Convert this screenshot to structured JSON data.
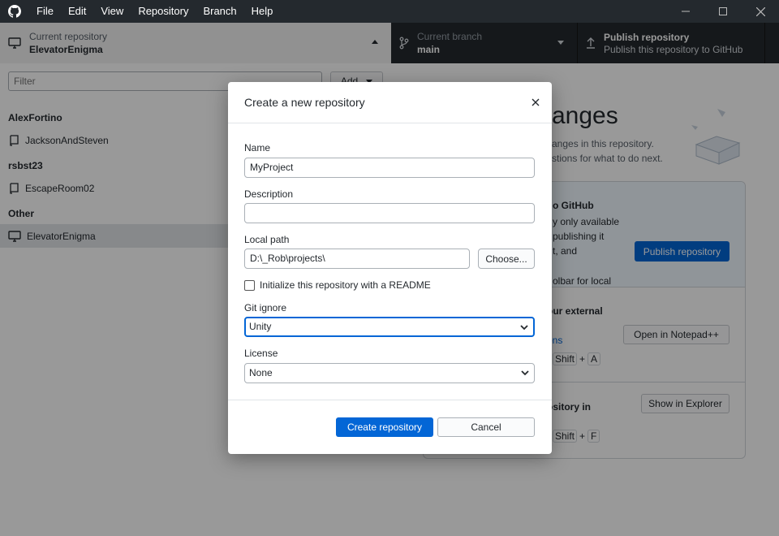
{
  "menu": [
    "File",
    "Edit",
    "View",
    "Repository",
    "Branch",
    "Help"
  ],
  "toolbar": {
    "repo_sub": "Current repository",
    "repo_main": "ElevatorEnigma",
    "branch_sub": "Current branch",
    "branch_main": "main",
    "publish_main": "Publish repository",
    "publish_sub": "Publish this repository to GitHub"
  },
  "sidebar": {
    "filter_placeholder": "Filter",
    "add_label": "Add",
    "groups": [
      {
        "name": "AlexFortino",
        "repos": [
          "JacksonAndSteven"
        ]
      },
      {
        "name": "rsbst23",
        "repos": [
          "EscapeRoom02"
        ]
      },
      {
        "name": "Other",
        "repos": [
          "ElevatorEnigma"
        ]
      }
    ]
  },
  "main": {
    "title_fragment": "anges",
    "sub_line1": "anges in this repository.",
    "sub_line2": "stions for what to do next.",
    "publish_heading_fragment": "o GitHub",
    "publish_text_1": "y only available",
    "publish_text_2": "publishing it",
    "publish_text_3": "t, and",
    "publish_text_4": "olbar for local",
    "publish_button": "Publish repository",
    "editor_heading_fragment": "our external",
    "editor_link_fragment": "ons",
    "editor_shortcut_sep": "-",
    "editor_shortcut_shift": "Shift",
    "editor_shortcut_plus": "+",
    "editor_shortcut_key": "A",
    "editor_button": "Open in Notepad++",
    "explorer_heading_fragment": "ository in",
    "explorer_shortcut_key": "F",
    "explorer_button": "Show in Explorer"
  },
  "dialog": {
    "title": "Create a new repository",
    "name_label": "Name",
    "name_value": "MyProject",
    "description_label": "Description",
    "description_value": "",
    "local_path_label": "Local path",
    "local_path_value": "D:\\_Rob\\projects\\",
    "choose_button": "Choose...",
    "readme_label": "Initialize this repository with a README",
    "gitignore_label": "Git ignore",
    "gitignore_value": "Unity",
    "license_label": "License",
    "license_value": "None",
    "create_button": "Create repository",
    "cancel_button": "Cancel"
  },
  "colors": {
    "accent": "#0366d6",
    "titlebar": "#24292e"
  }
}
